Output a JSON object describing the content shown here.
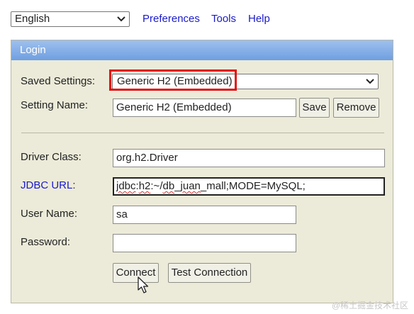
{
  "topbar": {
    "language": "English",
    "links": [
      "Preferences",
      "Tools",
      "Help"
    ]
  },
  "login": {
    "header": "Login",
    "saved_settings_label": "Saved Settings:",
    "saved_settings_value": "Generic H2 (Embedded)",
    "setting_name_label": "Setting Name:",
    "setting_name_value": "Generic H2 (Embedded)",
    "save_label": "Save",
    "remove_label": "Remove",
    "driver_class_label": "Driver Class:",
    "driver_class_value": "org.h2.Driver",
    "jdbc_url_label": "JDBC URL",
    "jdbc_url_colon": ":",
    "jdbc_url_parts": [
      "jdbc",
      ":",
      "h2",
      ":~/",
      "db",
      "_",
      "juan",
      "_mall;MODE=MySQL;"
    ],
    "user_name_label": "User Name:",
    "user_name_value": "sa",
    "password_label": "Password:",
    "password_value": "",
    "connect_label": "Connect",
    "test_connection_label": "Test Connection"
  },
  "watermark": "@稀土掘金技术社区",
  "colors": {
    "panel_bg": "#ecebd9",
    "header_gradient_top": "#9ec0ee",
    "header_gradient_bottom": "#6f9fe0",
    "link": "#1a1acc",
    "highlight": "#e01010"
  }
}
